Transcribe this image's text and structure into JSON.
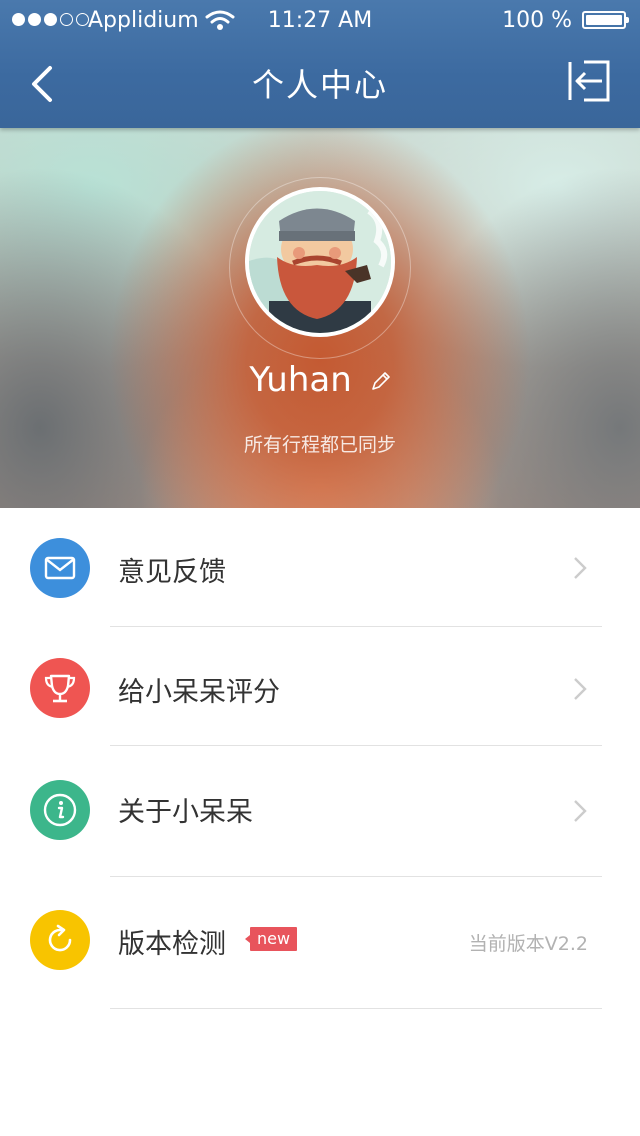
{
  "status_bar": {
    "carrier": "Applidium",
    "time": "11:27 AM",
    "battery": "100 %"
  },
  "nav": {
    "title": "个人中心",
    "back_icon": "chevron-left-icon",
    "logout_icon": "logout-icon"
  },
  "profile": {
    "username": "Yuhan",
    "sync_status": "所有行程都已同步"
  },
  "menu": {
    "items": [
      {
        "label": "意见反馈",
        "icon": "mail-icon",
        "color": "#3d8fdc"
      },
      {
        "label": "给小呆呆评分",
        "icon": "trophy-icon",
        "color": "#ef5552"
      },
      {
        "label": "关于小呆呆",
        "icon": "info-icon",
        "color": "#3cb68b"
      },
      {
        "label": "版本检测",
        "icon": "refresh-icon",
        "color": "#f8c400",
        "badge": "new",
        "version": "当前版本V2.2"
      }
    ]
  }
}
